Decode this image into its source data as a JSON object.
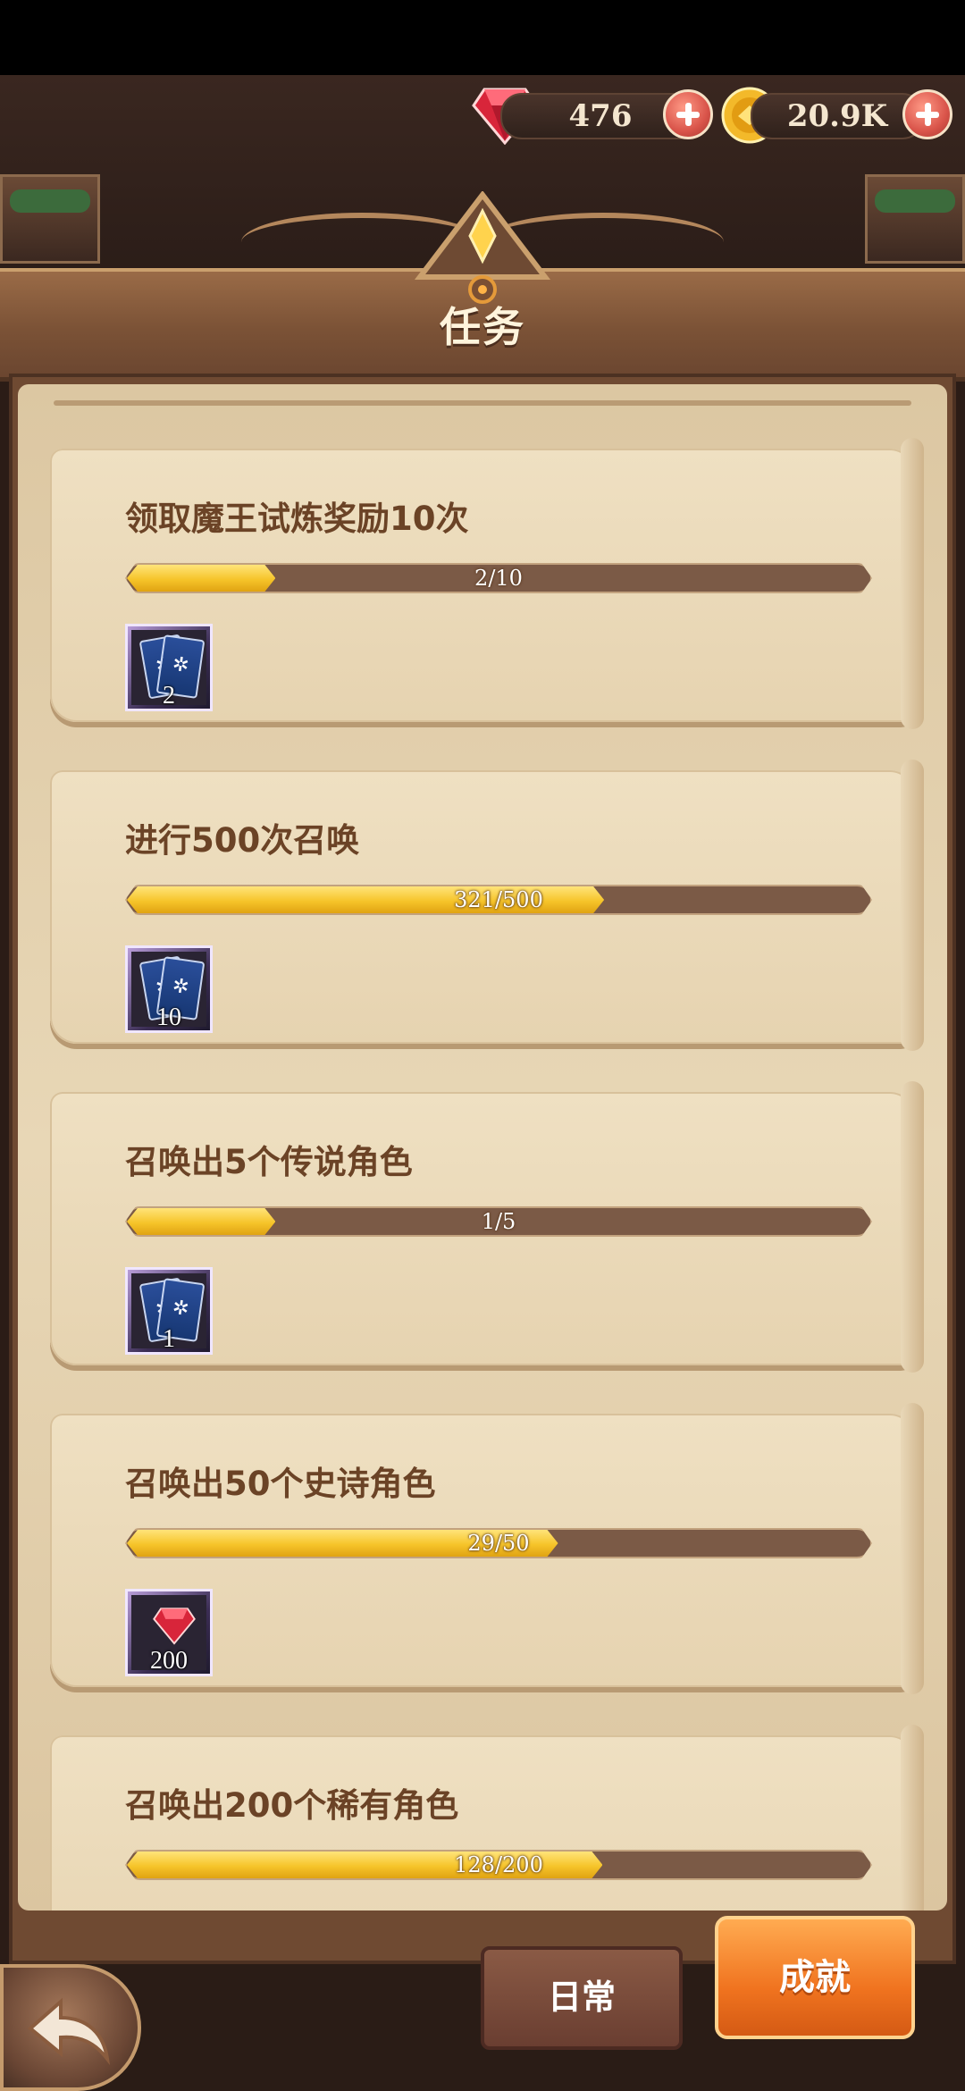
{
  "currency": {
    "gems": "476",
    "coins": "20.9K"
  },
  "header": {
    "title": "任务"
  },
  "quests": [
    {
      "title": "领取魔王试炼奖励10次",
      "progress": "2/10",
      "fill": 0.2,
      "reward_type": "card",
      "reward_amount": "2"
    },
    {
      "title": "进行500次召唤",
      "progress": "321/500",
      "fill": 0.642,
      "reward_type": "card",
      "reward_amount": "10"
    },
    {
      "title": "召唤出5个传说角色",
      "progress": "1/5",
      "fill": 0.2,
      "reward_type": "card",
      "reward_amount": "1"
    },
    {
      "title": "召唤出50个史诗角色",
      "progress": "29/50",
      "fill": 0.58,
      "reward_type": "gem",
      "reward_amount": "200"
    },
    {
      "title": "召唤出200个稀有角色",
      "progress": "128/200",
      "fill": 0.64,
      "reward_type": "card",
      "reward_amount": ""
    }
  ],
  "tabs": {
    "daily": "日常",
    "achievement": "成就"
  },
  "colors": {
    "bar_fill": "#f6c42a",
    "tab_active": "#f0731f",
    "title_text": "#6b4326"
  }
}
